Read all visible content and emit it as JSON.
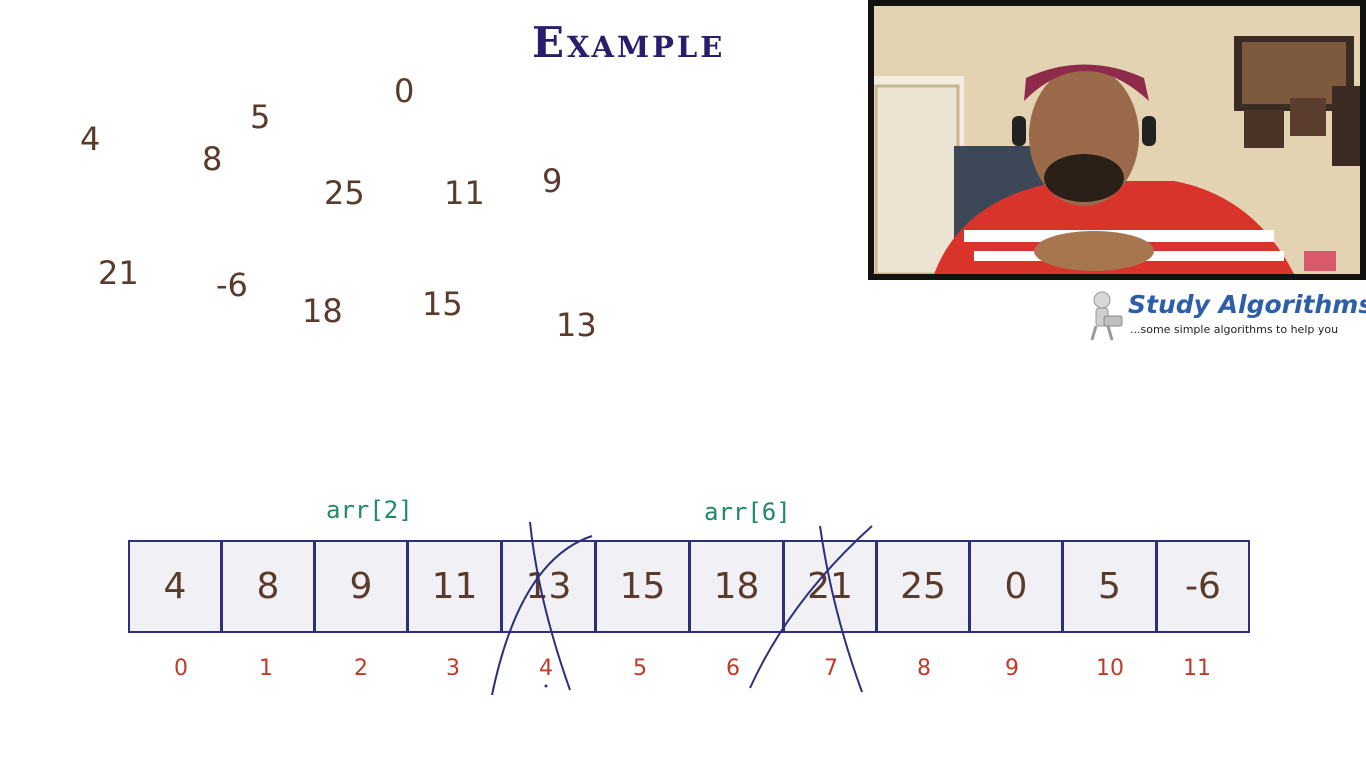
{
  "slide": {
    "title": "Example",
    "scattered_numbers": [
      "4",
      "5",
      "0",
      "8",
      "25",
      "11",
      "9",
      "21",
      "-6",
      "18",
      "15",
      "13"
    ],
    "array_values": [
      "4",
      "8",
      "9",
      "11",
      "13",
      "15",
      "18",
      "21",
      "25",
      "0",
      "5",
      "-6"
    ],
    "indices": [
      "0",
      "1",
      "2",
      "3",
      "4",
      "5",
      "6",
      "7",
      "8",
      "9",
      "10",
      "11"
    ],
    "labels": {
      "left": "arr[2]",
      "right": "arr[6]"
    },
    "crossed_out_indices": [
      4,
      7
    ]
  },
  "logo": {
    "title": "Study Algorithms",
    "tagline": "...some simple algorithms to help you"
  },
  "colors": {
    "title": "#2a1d6e",
    "numbers": "#5a3a2a",
    "index": "#c0392b",
    "label": "#1f8a6a",
    "cell_border": "#2d2f7a",
    "cell_fill": "#f1f0f5",
    "logo": "#2d5ea8",
    "ink": "#2d2f7a"
  },
  "icons": [
    "webcam-feed",
    "study-algorithms-logo-icon"
  ]
}
